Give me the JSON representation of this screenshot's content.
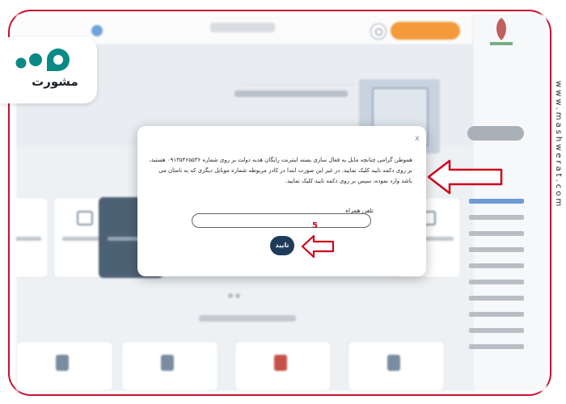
{
  "background_app": {
    "top_button_label": "",
    "sidebar_title": "",
    "sidebar_user": ""
  },
  "modal": {
    "close_label": "x",
    "message": "هموطن گرامی چنانچه مایل به فعال سازی بسته اینترنت رایگان هدیه دولت بر روی شماره ۰۹۱۳۵۴۶۵۵۳۶ هستید، بر روی دکمه تایید کلیک نمایید. در غیر این صورت ابتدا در کادر مربوطه شماره موبایل دیگری که به نامتان می باشد وارد نموده، سپس بر روی دکمه تایید کلیک نمایید.",
    "phone_label": "تلفن همراه",
    "phone_value": "",
    "phone_placeholder": "",
    "confirm_label": "تایید"
  },
  "annotations": {
    "step_number": "5",
    "arrow_color": "#d0021b"
  },
  "branding": {
    "logo_text": "مشورت",
    "watermark": "www.mashwerat.com",
    "logo_color": "#0b8a85",
    "frame_color": "#c8102e"
  }
}
